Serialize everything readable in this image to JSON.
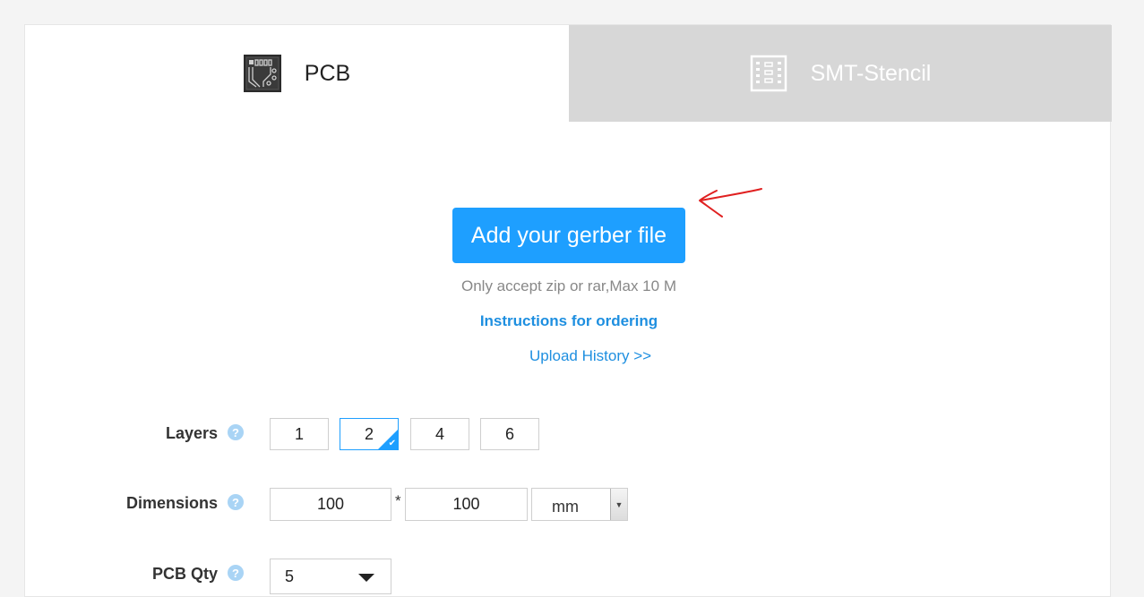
{
  "tabs": [
    {
      "label": "PCB",
      "icon": "pcb-board-icon",
      "active": true
    },
    {
      "label": "SMT-Stencil",
      "icon": "smt-stencil-icon",
      "active": false
    }
  ],
  "upload": {
    "button_label": "Add your gerber file",
    "accept_note": "Only accept zip or rar,Max 10 M",
    "instructions_link": "Instructions for ordering",
    "history_link": "Upload History >>"
  },
  "form": {
    "layers": {
      "label": "Layers",
      "help": "?",
      "options": [
        "1",
        "2",
        "4",
        "6"
      ],
      "selected": "2"
    },
    "dimensions": {
      "label": "Dimensions",
      "help": "?",
      "width": "100",
      "separator": "*",
      "height": "100",
      "unit": "mm"
    },
    "qty": {
      "label": "PCB Qty",
      "help": "?",
      "value": "5"
    }
  },
  "colors": {
    "accent": "#1e9fff",
    "link": "#1e8fe0",
    "inactive_tab": "#d7d7d7",
    "annotation_arrow": "#e02020"
  }
}
